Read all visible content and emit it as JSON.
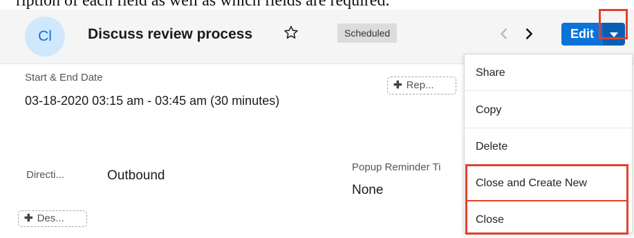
{
  "top_caption": "ription of each field as well as which fields are required.",
  "header": {
    "avatar_initials": "Cl",
    "title": "Discuss review process",
    "status": "Scheduled",
    "edit_label": "Edit"
  },
  "fields": {
    "start_end_label": "Start & End Date",
    "start_end_value": "03-18-2020 03:15 am - 03:45 am (30 minutes)",
    "repeat_button": "Rep...",
    "direction_label": "Directi...",
    "direction_value": "Outbound",
    "popup_reminder_label": "Popup Reminder Ti",
    "popup_reminder_value": "None",
    "description_button": "Des..."
  },
  "actions_menu": {
    "items": [
      "Share",
      "Copy",
      "Delete",
      "Close and Create New",
      "Close"
    ]
  },
  "colors": {
    "primary": "#0b73d8",
    "highlight": "#e0412c",
    "avatar_bg": "#cfe8fb"
  }
}
